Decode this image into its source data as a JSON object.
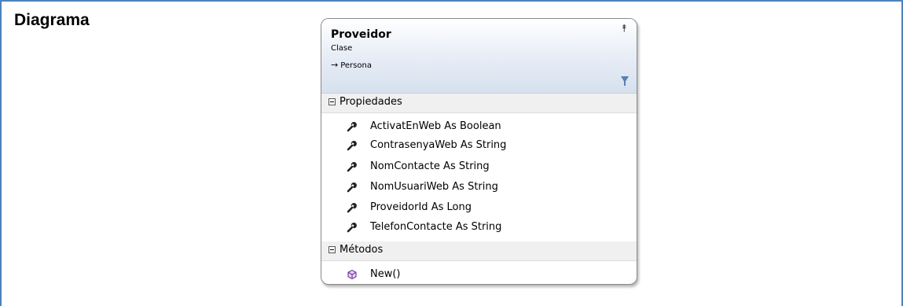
{
  "row_label": "Diagrama",
  "class_box": {
    "name": "Proveidor",
    "kind": "Clase",
    "base_arrow": "→",
    "base": "Persona",
    "icons": [
      "collapse-chevron-icon",
      "filter-icon"
    ]
  },
  "sections": {
    "properties": {
      "title": "Propiedades",
      "items": [
        "ActivatEnWeb As Boolean",
        "ContrasenyaWeb As String",
        "NomContacte As String",
        "NomUsuariWeb As String",
        "ProveidorId As Long",
        "TelefonContacte As String"
      ]
    },
    "methods": {
      "title": "Métodos",
      "items": [
        "New()"
      ]
    }
  },
  "colors": {
    "frame_border": "#4f81bd",
    "header_gradient_end": "#d6e0ee",
    "method_icon": "#7a3ea8"
  }
}
